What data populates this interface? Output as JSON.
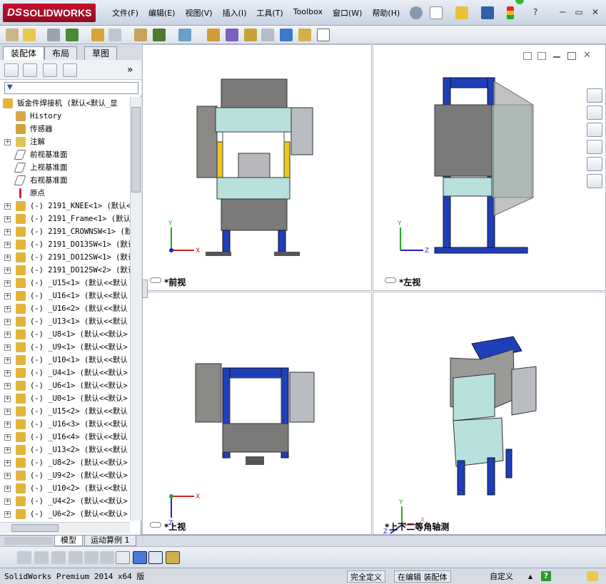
{
  "app": {
    "logo_prefix": "DS",
    "logo_text": "SOLIDWORKS"
  },
  "menu": [
    "文件(F)",
    "编辑(E)",
    "视图(V)",
    "插入(I)",
    "工具(T)",
    "Toolbox",
    "窗口(W)",
    "帮助(H)"
  ],
  "title_controls": {
    "help_label": "?",
    "minimize": "─",
    "restore": "▭",
    "close": "✕"
  },
  "left_panel": {
    "tabs": [
      {
        "label": "装配体",
        "active": true
      },
      {
        "label": "布局",
        "active": false
      },
      {
        "label": "草图",
        "active": false
      }
    ],
    "more_label": "»",
    "filter_icon": "▼",
    "tree": [
      {
        "label": "钣金件焊接机  (默认<默认_显",
        "icon": "assembly-icon",
        "expand": "",
        "indent": 0
      },
      {
        "label": "History",
        "icon": "history-icon",
        "expand": "",
        "indent": 1
      },
      {
        "label": "传感器",
        "icon": "sensor-icon",
        "expand": "",
        "indent": 1
      },
      {
        "label": "注解",
        "icon": "annotation-icon",
        "expand": "+",
        "indent": 1
      },
      {
        "label": "前视基准面",
        "icon": "plane-icon",
        "expand": "",
        "indent": 1
      },
      {
        "label": "上视基准面",
        "icon": "plane-icon",
        "expand": "",
        "indent": 1
      },
      {
        "label": "右视基准面",
        "icon": "plane-icon",
        "expand": "",
        "indent": 1
      },
      {
        "label": "原点",
        "icon": "origin-icon",
        "expand": "",
        "indent": 1
      },
      {
        "label": "(-) 2191_KNEE<1> (默认<",
        "icon": "subassembly-icon",
        "expand": "+",
        "indent": 1
      },
      {
        "label": "(-) 2191_Frame<1> (默认",
        "icon": "subassembly-icon",
        "expand": "+",
        "indent": 1
      },
      {
        "label": "(-) 2191_CROWNSW<1> (默",
        "icon": "subassembly-icon",
        "expand": "+",
        "indent": 1
      },
      {
        "label": "(-) 2191_DO13SW<1> (默认",
        "icon": "subassembly-icon",
        "expand": "+",
        "indent": 1
      },
      {
        "label": "(-) 2191_DO12SW<1> (默认",
        "icon": "subassembly-icon",
        "expand": "+",
        "indent": 1
      },
      {
        "label": "(-) 2191_DO12SW<2> (默认",
        "icon": "subassembly-icon",
        "expand": "+",
        "indent": 1
      },
      {
        "label": "(-) _U15<1> (默认<<默认",
        "icon": "subassembly-icon",
        "expand": "+",
        "indent": 1
      },
      {
        "label": "(-) _U16<1> (默认<<默认",
        "icon": "subassembly-icon",
        "expand": "+",
        "indent": 1
      },
      {
        "label": "(-) _U16<2> (默认<<默认",
        "icon": "subassembly-icon",
        "expand": "+",
        "indent": 1
      },
      {
        "label": "(-) _U13<1> (默认<<默认",
        "icon": "subassembly-icon",
        "expand": "+",
        "indent": 1
      },
      {
        "label": "(-) _U8<1> (默认<<默认>",
        "icon": "subassembly-icon",
        "expand": "+",
        "indent": 1
      },
      {
        "label": "(-) _U9<1> (默认<<默认>",
        "icon": "subassembly-icon",
        "expand": "+",
        "indent": 1
      },
      {
        "label": "(-) _U10<1> (默认<<默认",
        "icon": "subassembly-icon",
        "expand": "+",
        "indent": 1
      },
      {
        "label": "(-) _U4<1> (默认<<默认>",
        "icon": "subassembly-icon",
        "expand": "+",
        "indent": 1
      },
      {
        "label": "(-) _U6<1> (默认<<默认>",
        "icon": "subassembly-icon",
        "expand": "+",
        "indent": 1
      },
      {
        "label": "(-) _U0<1> (默认<<默认>",
        "icon": "subassembly-icon",
        "expand": "+",
        "indent": 1
      },
      {
        "label": "(-) _U15<2> (默认<<默认",
        "icon": "subassembly-icon",
        "expand": "+",
        "indent": 1
      },
      {
        "label": "(-) _U16<3> (默认<<默认",
        "icon": "subassembly-icon",
        "expand": "+",
        "indent": 1
      },
      {
        "label": "(-) _U16<4> (默认<<默认",
        "icon": "subassembly-icon",
        "expand": "+",
        "indent": 1
      },
      {
        "label": "(-) _U13<2> (默认<<默认",
        "icon": "subassembly-icon",
        "expand": "+",
        "indent": 1
      },
      {
        "label": "(-) _U8<2> (默认<<默认>",
        "icon": "subassembly-icon",
        "expand": "+",
        "indent": 1
      },
      {
        "label": "(-) _U9<2> (默认<<默认>",
        "icon": "subassembly-icon",
        "expand": "+",
        "indent": 1
      },
      {
        "label": "(-) _U10<2> (默认<<默认",
        "icon": "subassembly-icon",
        "expand": "+",
        "indent": 1
      },
      {
        "label": "(-) _U4<2> (默认<<默认>",
        "icon": "subassembly-icon",
        "expand": "+",
        "indent": 1
      },
      {
        "label": "(-) _U6<2> (默认<<默认>",
        "icon": "subassembly-icon",
        "expand": "+",
        "indent": 1
      }
    ]
  },
  "views": {
    "front": {
      "label": "*前视",
      "axis_x": "X",
      "axis_y": "Y"
    },
    "left": {
      "label": "*左视",
      "axis_z": "Z",
      "axis_y": "Y"
    },
    "top": {
      "label": "*上视",
      "axis_x": "X",
      "axis_z": "Z"
    },
    "iso": {
      "label": "*上下二等角轴测",
      "axis_x": "X",
      "axis_y": "Y",
      "axis_z": "Z"
    }
  },
  "bottom_tabs": [
    {
      "label": "模型",
      "active": true
    },
    {
      "label": "运动算例 1",
      "active": false
    }
  ],
  "status": {
    "product": "SolidWorks Premium 2014 x64 版",
    "definition": "完全定义",
    "editing": "在编辑 装配体",
    "custom": "自定义",
    "help": "?"
  },
  "colors": {
    "frame_blue": "#1f3fb8",
    "panel_cyan": "#b8e0dc",
    "steel_gray": "#7b7a78",
    "logo_red": "#c8102e"
  }
}
